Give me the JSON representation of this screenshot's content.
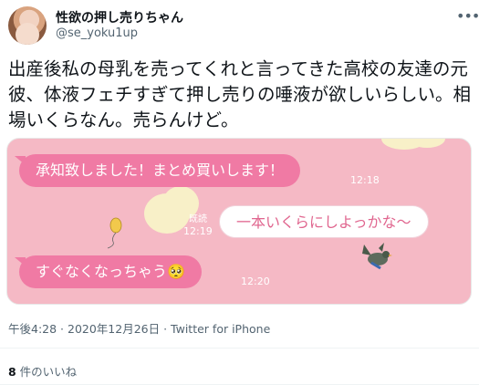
{
  "author": {
    "display_name": "性欲の押し売りちゃん",
    "handle": "@se_yoku1up"
  },
  "tweet": {
    "text": "出産後私の母乳を売ってくれと言ってきた高校の友達の元彼、体液フェチすぎて押し売りの唾液が欲しいらしい。相場いくらなん。売らんけど。",
    "timestamp": "午後4:28 · 2020年12月26日",
    "source_sep": " · ",
    "source": "Twitter for iPhone"
  },
  "chat": {
    "messages": [
      {
        "side": "in",
        "text": "承知致しました！まとめ買いします！",
        "time": "12:18"
      },
      {
        "side": "out",
        "text": "一本いくらにしよっかな〜",
        "time": "12:19",
        "read": "既読"
      },
      {
        "side": "in",
        "text": "すぐなくなっちゃう🥺",
        "time": "12:20"
      }
    ]
  },
  "engagement": {
    "like_count": "8",
    "like_label": " 件のいいね"
  },
  "icons": {
    "more": "more-icon",
    "balloon": "balloon-icon",
    "bird": "bird-icon"
  },
  "colors": {
    "chat_background": "#f5b9c5",
    "incoming_bubble": "#f07aa4",
    "outgoing_bubble": "#ffffff"
  }
}
